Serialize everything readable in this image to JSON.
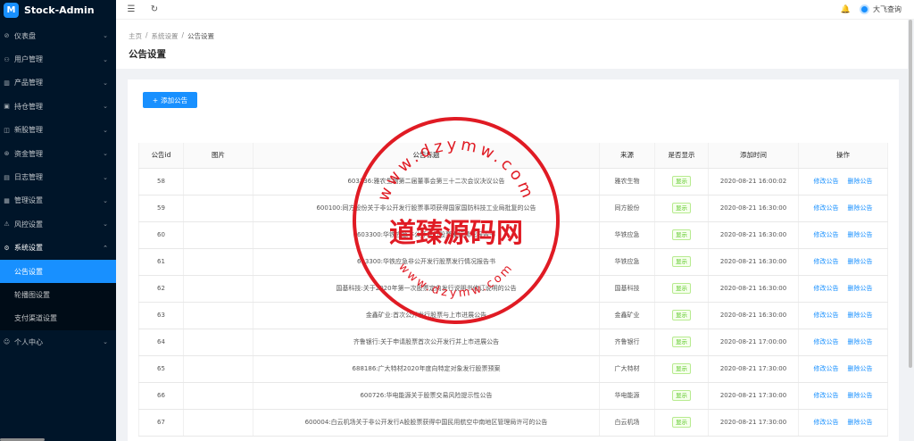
{
  "app": {
    "title": "Stock-Admin",
    "logo_letter": "M"
  },
  "sidebar": {
    "items": [
      {
        "icon": "⊘",
        "label": "仪表盘",
        "icon_name": "dashboard-icon"
      },
      {
        "icon": "⚇",
        "label": "用户管理",
        "icon_name": "user-icon"
      },
      {
        "icon": "▥",
        "label": "产品管理",
        "icon_name": "product-icon"
      },
      {
        "icon": "▣",
        "label": "持仓管理",
        "icon_name": "position-icon"
      },
      {
        "icon": "◫",
        "label": "新股管理",
        "icon_name": "ipo-icon"
      },
      {
        "icon": "⊛",
        "label": "资金管理",
        "icon_name": "funds-icon"
      },
      {
        "icon": "▤",
        "label": "日志管理",
        "icon_name": "log-icon"
      },
      {
        "icon": "▦",
        "label": "管理设置",
        "icon_name": "admin-settings-icon"
      },
      {
        "icon": "⚠",
        "label": "风控设置",
        "icon_name": "risk-icon"
      },
      {
        "icon": "⚙",
        "label": "系统设置",
        "icon_name": "system-settings-icon"
      }
    ],
    "sub_items": [
      "公告设置",
      "轮播图设置",
      "支付渠道设置"
    ],
    "last_item": {
      "icon": "☺",
      "label": "个人中心",
      "icon_name": "personal-center-icon"
    }
  },
  "header": {
    "menu_icon": "☰",
    "refresh_icon": "↻",
    "bell_icon": "🔔",
    "user_name": "大飞查询"
  },
  "breadcrumb": [
    "主页",
    "系统设置",
    "公告设置"
  ],
  "page_title": "公告设置",
  "add_button": "添加公告",
  "table": {
    "headers": [
      "公告id",
      "图片",
      "公告标题",
      "来源",
      "是否显示",
      "添加时间",
      "操作"
    ],
    "rows": [
      {
        "id": "58",
        "title": "603336:雅农生物第二届董事会第三十二次会议决议公告",
        "source": "雅农生物",
        "show": "显示",
        "time": "2020-08-21 16:00:02"
      },
      {
        "id": "59",
        "title": "600100:同方股份关于非公开发行股票事项获得国家国防科技工业局批复的公告",
        "source": "同方股份",
        "show": "显示",
        "time": "2020-08-21 16:30:00"
      },
      {
        "id": "60",
        "title": "603300:华铁应急非公开发行股票发行情况报告书",
        "source": "华铁应急",
        "show": "显示",
        "time": "2020-08-21 16:30:00"
      },
      {
        "id": "61",
        "title": "603300:华铁应急非公开发行股票发行情况报告书",
        "source": "华铁应急",
        "show": "显示",
        "time": "2020-08-21 16:30:00"
      },
      {
        "id": "62",
        "title": "国基科技:关于2020年第一次股票定向发行说明书修订说明的公告",
        "source": "国基科技",
        "show": "显示",
        "time": "2020-08-21 16:30:00"
      },
      {
        "id": "63",
        "title": "金鑫矿业:首次公开发行股票与上市进展公告",
        "source": "金鑫矿业",
        "show": "显示",
        "time": "2020-08-21 16:30:00"
      },
      {
        "id": "64",
        "title": "齐鲁银行:关于申请股票首次公开发行并上市进展公告",
        "source": "齐鲁银行",
        "show": "显示",
        "time": "2020-08-21 17:00:00"
      },
      {
        "id": "65",
        "title": "688186:广大特材2020年度向特定对象发行股票预案",
        "source": "广大特材",
        "show": "显示",
        "time": "2020-08-21 17:30:00"
      },
      {
        "id": "66",
        "title": "600726:华电能源关于股票交易风险提示性公告",
        "source": "华电能源",
        "show": "显示",
        "time": "2020-08-21 17:30:00"
      },
      {
        "id": "67",
        "title": "600004:白云机场关于非公开发行A股股票获得中国民用航空中南地区管理局许可的公告",
        "source": "白云机场",
        "show": "显示",
        "time": "2020-08-21 17:30:00"
      }
    ],
    "edit_label": "修改公告",
    "delete_label": "删除公告"
  },
  "watermark": {
    "main": "道臻源码网",
    "ring_top": "www.dzymw.com",
    "ring_bottom": "www.dzymw.com",
    "color": "#e01b24"
  }
}
